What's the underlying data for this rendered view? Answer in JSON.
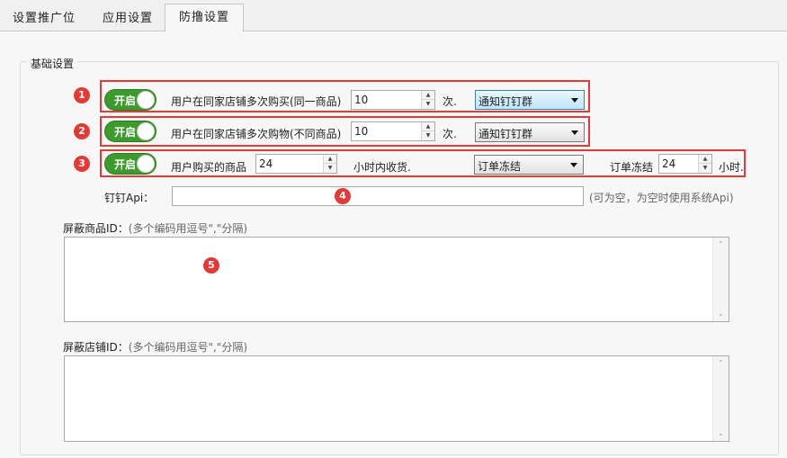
{
  "tabs": [
    {
      "label": "设置推广位"
    },
    {
      "label": "应用设置"
    },
    {
      "label": "防撸设置"
    }
  ],
  "group_title": "基础设置",
  "rules": [
    {
      "badge": "1",
      "toggle_label": "开启",
      "description": "用户在同家店铺多次购买(同一商品)",
      "count": "10",
      "unit": "次.",
      "action": "通知钉钉群"
    },
    {
      "badge": "2",
      "toggle_label": "开启",
      "description": "用户在同家店铺多次购物(不同商品)",
      "count": "10",
      "unit": "次.",
      "action": "通知钉钉群"
    },
    {
      "badge": "3",
      "toggle_label": "开启",
      "description": "用户购买的商品",
      "count": "24",
      "unit": "小时内收货.",
      "action": "订单冻结",
      "freeze_label": "订单冻结",
      "freeze_value": "24",
      "freeze_unit": "小时."
    }
  ],
  "dingtalk": {
    "label": "钉钉Api：",
    "value": "",
    "badge": "4",
    "hint": "(可为空，为空时使用系统Api)"
  },
  "block_goods": {
    "label": "屏蔽商品ID：",
    "hint": "(多个编码用逗号\",\"分隔)",
    "badge": "5",
    "value": ""
  },
  "block_shops": {
    "label": "屏蔽店铺ID：",
    "hint": "(多个编码用逗号\",\"分隔)",
    "value": ""
  },
  "colors": {
    "toggle_on": "#3d9a2d",
    "highlight": "#e53935"
  }
}
